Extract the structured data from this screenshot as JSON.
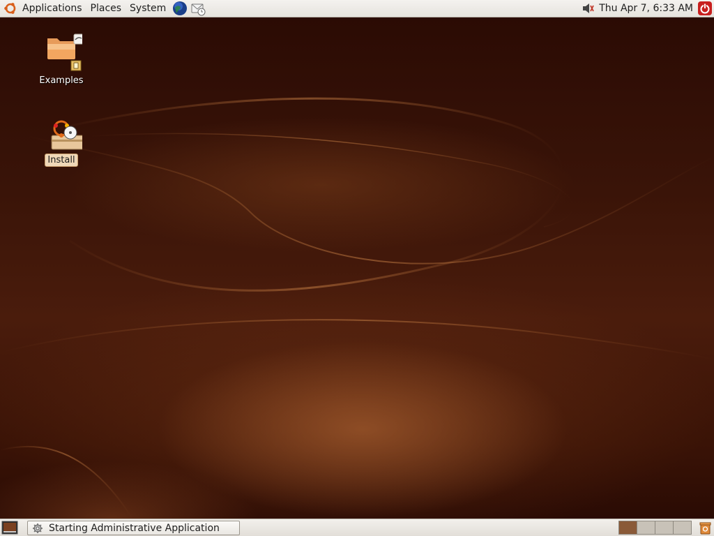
{
  "top_panel": {
    "menus": {
      "applications": "Applications",
      "places": "Places",
      "system": "System"
    },
    "launchers": [
      "web-browser-icon",
      "email-client-icon"
    ],
    "clock": "Thu Apr  7,  6:33 AM",
    "tray_icons": [
      "volume-icon",
      "power-icon"
    ]
  },
  "desktop": {
    "icons": [
      {
        "name": "Examples",
        "icon": "folder-icon"
      },
      {
        "name": "Install",
        "icon": "installer-icon"
      }
    ]
  },
  "bottom_panel": {
    "show_desktop_icon": "show-desktop-icon",
    "task": {
      "label": "Starting Administrative Application",
      "icon": "gear-icon"
    },
    "workspaces": [
      true,
      false,
      false,
      false
    ],
    "trash_icon": "trash-icon"
  },
  "colors": {
    "panel": "#e8e5e0",
    "wallpaper": "#3a1408",
    "active_workspace": "#8a5a38"
  }
}
